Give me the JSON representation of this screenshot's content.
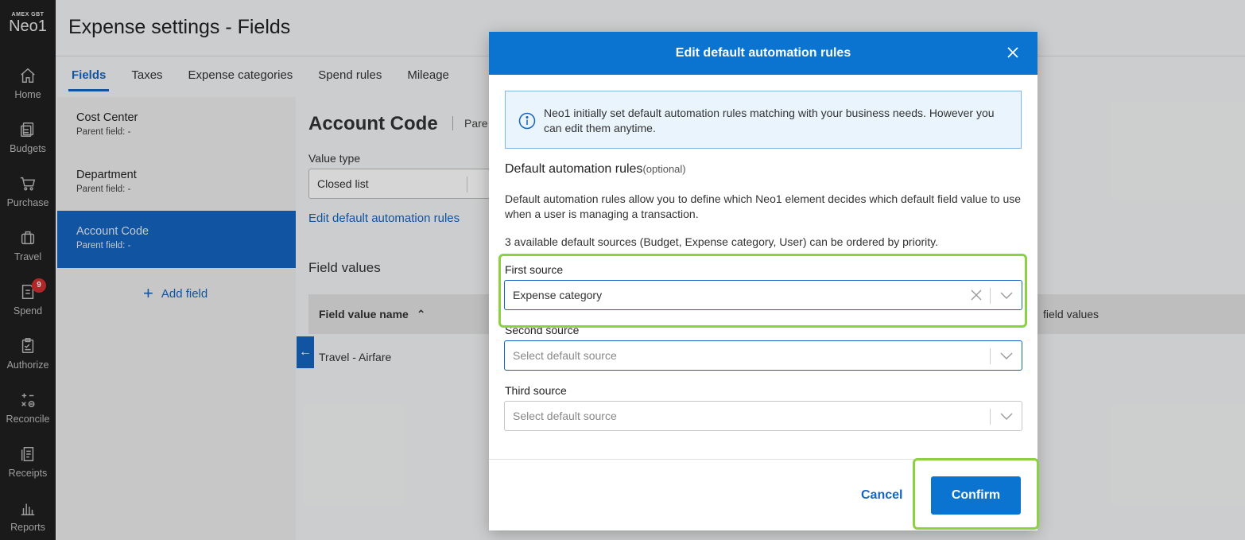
{
  "brand": {
    "small": "AMEX GBT",
    "name": "Neo1"
  },
  "nav": [
    {
      "label": "Home",
      "icon": "home-icon"
    },
    {
      "label": "Budgets",
      "icon": "budgets-icon"
    },
    {
      "label": "Purchase",
      "icon": "cart-icon"
    },
    {
      "label": "Travel",
      "icon": "suitcase-icon"
    },
    {
      "label": "Spend",
      "icon": "receipt-icon",
      "badge": "9"
    },
    {
      "label": "Authorize",
      "icon": "clipboard-icon"
    },
    {
      "label": "Reconcile",
      "icon": "calc-icon"
    },
    {
      "label": "Receipts",
      "icon": "receipts-icon"
    },
    {
      "label": "Reports",
      "icon": "chart-icon"
    }
  ],
  "page": {
    "title": "Expense settings - Fields"
  },
  "tabs": [
    "Fields",
    "Taxes",
    "Expense categories",
    "Spend rules",
    "Mileage"
  ],
  "fields": [
    {
      "name": "Cost Center",
      "parent": "Parent field:  -"
    },
    {
      "name": "Department",
      "parent": "Parent field:  -"
    },
    {
      "name": "Account Code",
      "parent": "Parent field:  -"
    }
  ],
  "add_field": "Add field",
  "detail": {
    "title": "Account Code",
    "parent": "Pare",
    "value_type_label": "Value type",
    "value_type": "Closed list",
    "edit_link": "Edit default automation rules",
    "field_values_title": "Field values",
    "col_name": "Field value name",
    "col_right": "field values",
    "row1": "Travel - Airfare"
  },
  "modal": {
    "title": "Edit default automation rules",
    "info": "Neo1 initially set default automation rules matching with your business needs. However you can edit them anytime.",
    "section_title": "Default automation rules",
    "optional": "(optional)",
    "desc1": "Default automation rules allow you to define which Neo1 element decides which default field value to use when a user is managing a transaction.",
    "desc2": "3 available default sources (Budget, Expense category, User) can be ordered by priority.",
    "first_label": "First source",
    "first_value": "Expense category",
    "second_label": "Second source",
    "second_placeholder": "Select default source",
    "third_label": "Third source",
    "third_placeholder": "Select default source",
    "cancel": "Cancel",
    "confirm": "Confirm"
  },
  "colors": {
    "primary": "#0b74d1",
    "highlight": "#8bd140",
    "nav_bg": "#1f1f1f"
  }
}
